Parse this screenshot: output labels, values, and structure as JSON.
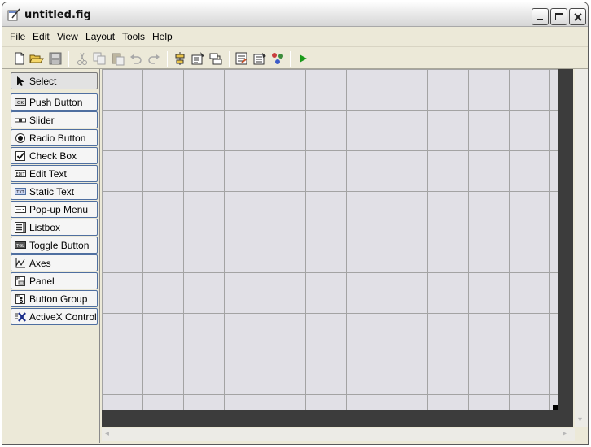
{
  "window": {
    "title": "untitled.fig",
    "controls": {
      "minimize_icon": "minimize-icon",
      "maximize_icon": "maximize-icon",
      "close_icon": "close-icon"
    }
  },
  "menu": [
    {
      "label": "File",
      "underline": "F",
      "rest": "ile"
    },
    {
      "label": "Edit",
      "underline": "E",
      "rest": "dit"
    },
    {
      "label": "View",
      "underline": "V",
      "rest": "iew"
    },
    {
      "label": "Layout",
      "underline": "L",
      "rest": "ayout"
    },
    {
      "label": "Tools",
      "underline": "T",
      "rest": "ools"
    },
    {
      "label": "Help",
      "underline": "H",
      "rest": "elp"
    }
  ],
  "toolbar": [
    "new-file-icon",
    "open-folder-icon",
    "save-icon",
    "cut-icon",
    "copy-icon",
    "paste-icon",
    "undo-icon",
    "redo-icon",
    "align-objects-icon",
    "menu-editor-icon",
    "tab-order-editor-icon",
    "m-file-editor-icon",
    "property-inspector-icon",
    "object-browser-icon",
    "run-icon"
  ],
  "palette": [
    {
      "label": "Select",
      "icon": "arrow-pointer-icon"
    },
    {
      "label": "Push Button",
      "icon": "push-button-icon"
    },
    {
      "label": "Slider",
      "icon": "slider-icon"
    },
    {
      "label": "Radio Button",
      "icon": "radio-button-icon"
    },
    {
      "label": "Check Box",
      "icon": "check-box-icon"
    },
    {
      "label": "Edit Text",
      "icon": "edit-text-icon"
    },
    {
      "label": "Static Text",
      "icon": "static-text-icon"
    },
    {
      "label": "Pop-up Menu",
      "icon": "popup-menu-icon"
    },
    {
      "label": "Listbox",
      "icon": "listbox-icon"
    },
    {
      "label": "Toggle Button",
      "icon": "toggle-button-icon"
    },
    {
      "label": "Axes",
      "icon": "axes-icon"
    },
    {
      "label": "Panel",
      "icon": "panel-icon"
    },
    {
      "label": "Button Group",
      "icon": "button-group-icon"
    },
    {
      "label": "ActiveX Control",
      "icon": "activex-control-icon"
    }
  ],
  "palette_icon_text": {
    "push": "OK",
    "edit": "EDIT",
    "static": "TXT",
    "toggle": "TGL"
  },
  "colors": {
    "window_bg": "#ece9d8",
    "canvas_bg": "#e1e0e6",
    "grid_line": "#a3a3a3",
    "canvas_edge": "#3c3c3c",
    "palette_border": "#4f6fa0",
    "run_green": "#1a9a1a"
  }
}
